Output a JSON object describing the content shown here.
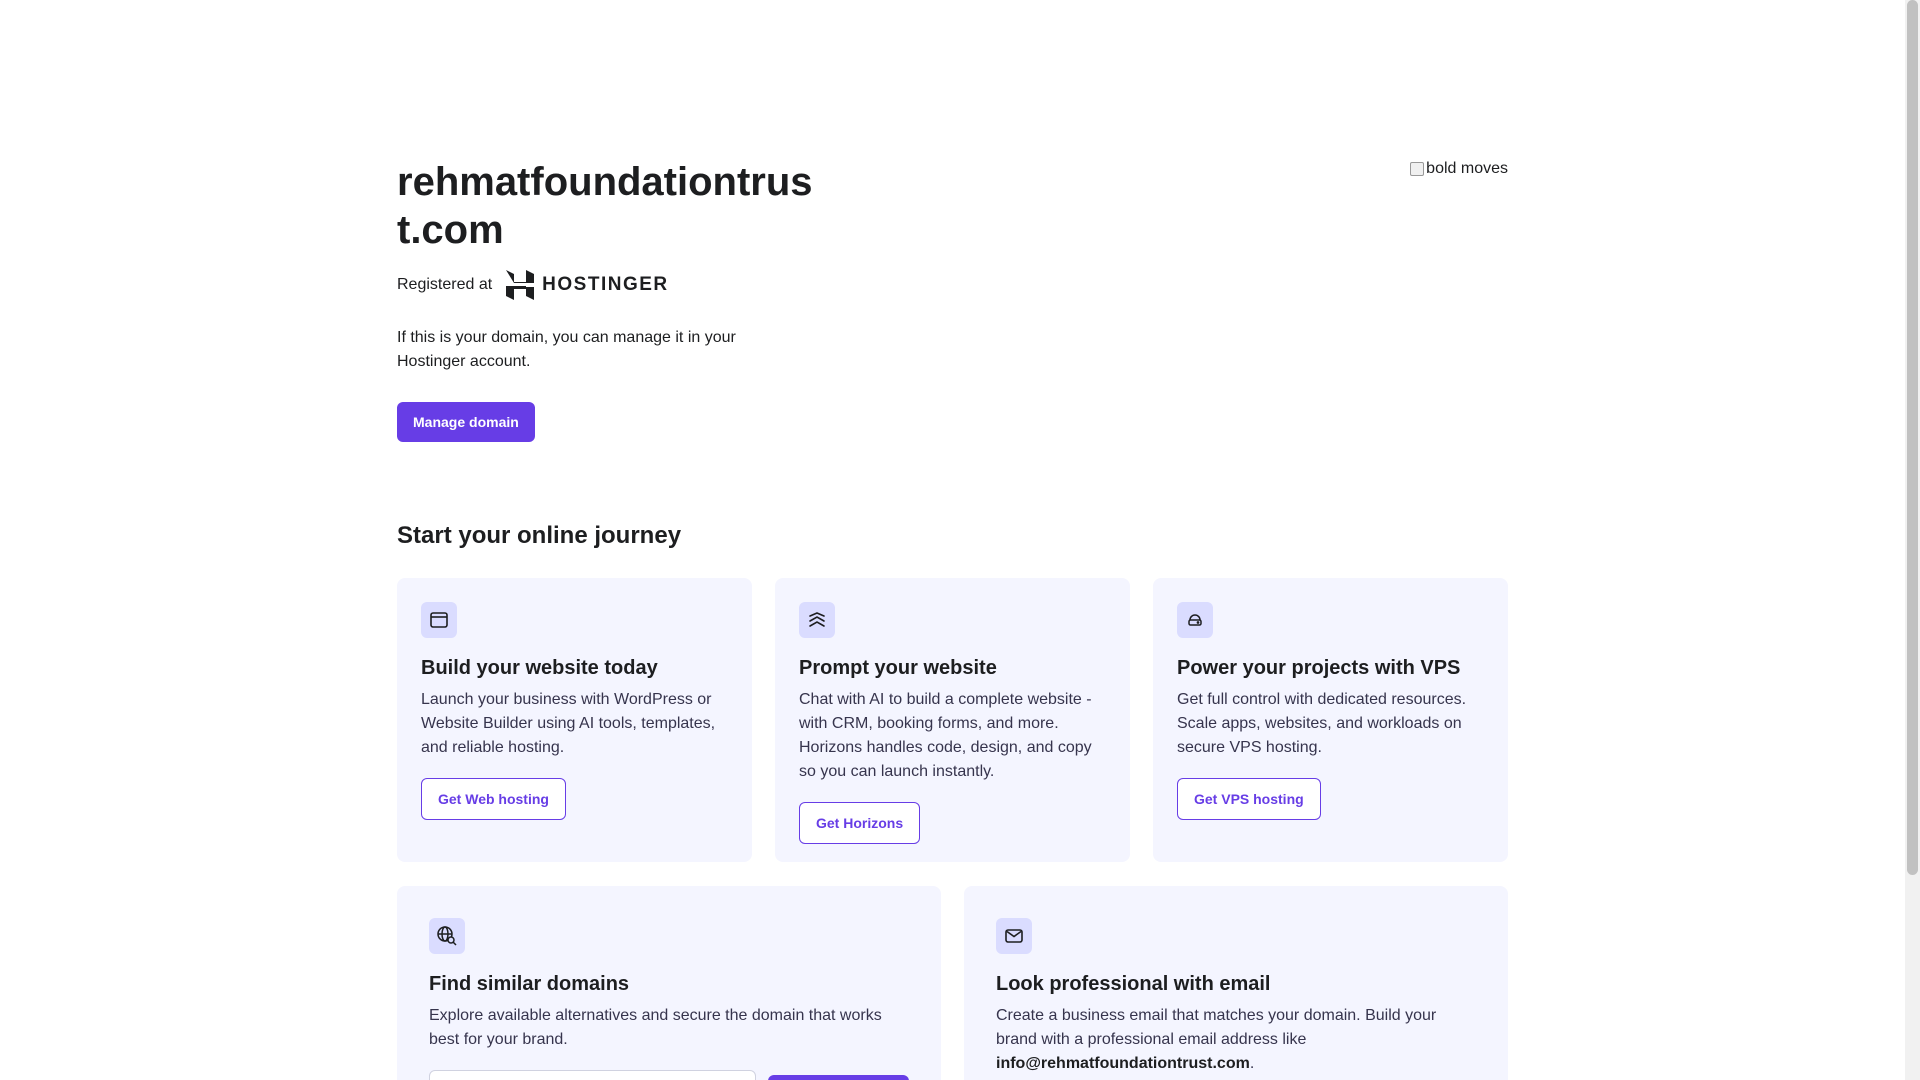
{
  "hero": {
    "domain": "rehmatfoundationtrust.com",
    "registered_label": "Registered at",
    "registrar_name": "HOSTINGER",
    "registrar_logo_icon": "hostinger-logo-icon",
    "manage_text": "If this is your domain, you can manage it in your Hostinger account.",
    "manage_button": "Manage domain",
    "side_image_alt": "bold moves"
  },
  "journey": {
    "title": "Start your online journey",
    "cards": [
      {
        "icon": "browser-window-icon",
        "title": "Build your website today",
        "text": "Launch your business with WordPress or Website Builder using AI tools, templates, and reliable hosting.",
        "button": "Get Web hosting"
      },
      {
        "icon": "horizons-waves-icon",
        "title": "Prompt your website",
        "text": "Chat with AI to build a complete website - with CRM, booking forms, and more. Horizons handles code, design, and copy so you can launch instantly.",
        "button": "Get Horizons"
      },
      {
        "icon": "cloud-server-icon",
        "title": "Power your projects with VPS",
        "text": "Get full control with dedicated resources. Scale apps, websites, and workloads on secure VPS hosting.",
        "button": "Get VPS hosting"
      }
    ],
    "domains_card": {
      "icon": "globe-search-icon",
      "title": "Find similar domains",
      "text": "Explore available alternatives and secure the domain that works best for your brand.",
      "search_placeholder": "",
      "search_button": ""
    },
    "email_card": {
      "icon": "mail-icon",
      "title": "Look professional with email",
      "text": "Create a business email that matches your domain. Build your brand with a professional email address like",
      "email": "info@rehmatfoundationtrust.com",
      "period": "."
    }
  },
  "colors": {
    "accent": "#673de6",
    "card_bg": "#f4f5ff",
    "icon_bg": "#dadcff"
  }
}
